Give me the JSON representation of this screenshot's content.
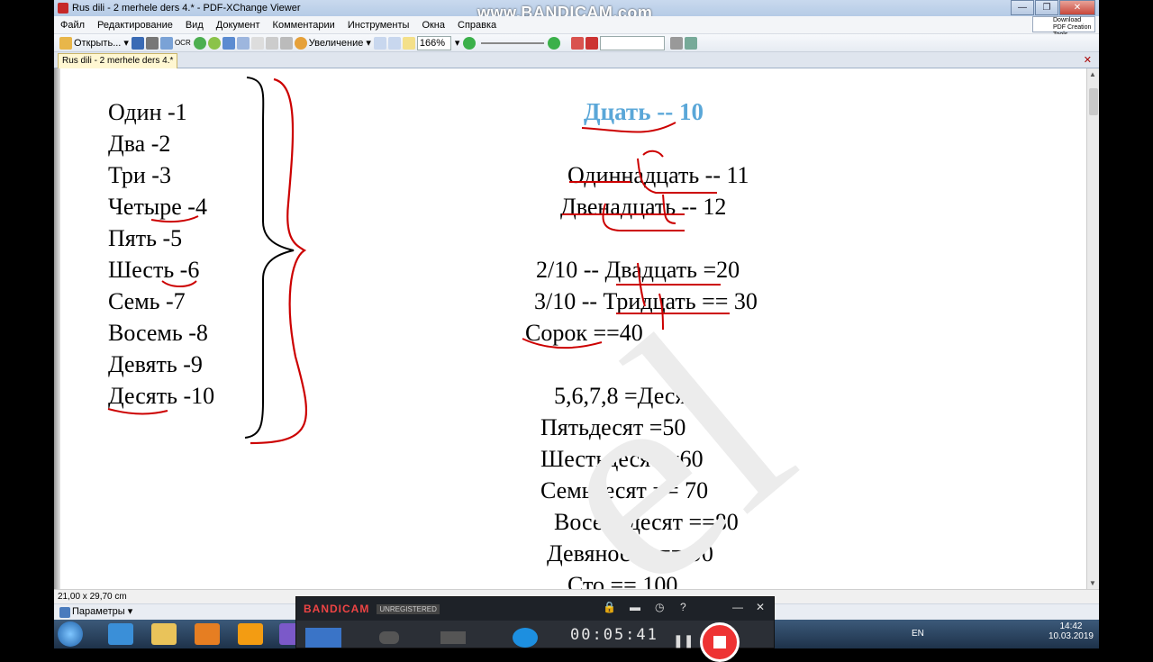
{
  "window": {
    "title": "Rus dili  - 2 merhele ders 4.* - PDF-XChange Viewer",
    "watermark": "www.BANDICAM.com"
  },
  "menu": [
    "Файл",
    "Редактирование",
    "Вид",
    "Документ",
    "Комментарии",
    "Инструменты",
    "Окна",
    "Справка"
  ],
  "download": {
    "label": "Download PDF Creation Tools"
  },
  "toolbar": {
    "open_label": "Открыть...",
    "ocr_label": "OCR",
    "zoom_label": "Увеличение",
    "zoom_value": "166%"
  },
  "tab": {
    "label": "Rus dili  - 2 merhele ders 4.*"
  },
  "document": {
    "left_list": [
      "Один -1",
      "Два -2",
      "Три -3",
      "Четыре -4",
      "Пять -5",
      "Шесть -6",
      "Семь -7",
      "Восемь -8",
      "Девять -9",
      "Десять -10"
    ],
    "heading": "Дцать -- 10",
    "right_lines": [
      "Одиннадцать -- 11",
      "Двенадцать -- 12",
      "2/10 -- Двадцать  =20",
      "3/10 -- Тридцать == 30",
      "Сорок  ==40",
      "5,6,7,8 =Десять",
      "Пятьдесят  =50",
      "Шестьдесят =60",
      "Семьдесят == 70",
      "Восемьдесят ==80",
      "Девяносто == 90",
      "Сто == 100"
    ],
    "faint_watermark": "el"
  },
  "status": {
    "page_size": "21,00 x 29,70 cm"
  },
  "params": {
    "label": "Параметры"
  },
  "bandicam": {
    "logo_a": "BANDI",
    "logo_b": "CAM",
    "unregistered": "UNREGISTERED",
    "timer": "00:05:41"
  },
  "taskbar": {
    "lang": "EN",
    "time": "14:42",
    "date": "10.03.2019"
  }
}
